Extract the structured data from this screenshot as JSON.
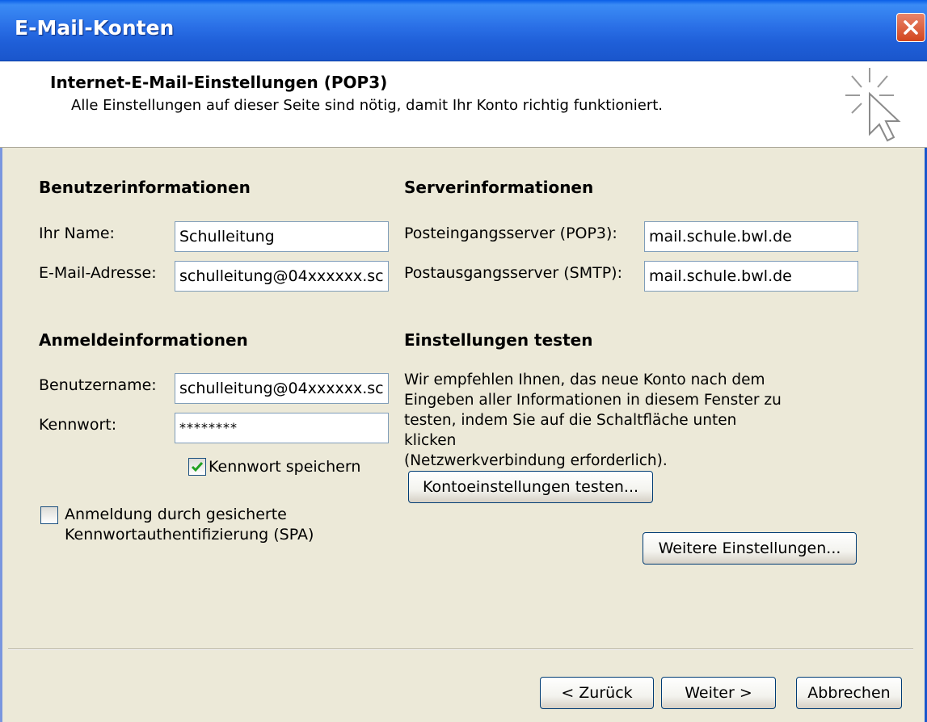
{
  "window": {
    "title": "E-Mail-Konten"
  },
  "header": {
    "title": "Internet-E-Mail-Einstellungen (POP3)",
    "subtitle": "Alle Einstellungen auf dieser Seite sind nötig, damit Ihr Konto richtig funktioniert."
  },
  "user_info": {
    "heading": "Benutzerinformationen",
    "name_label": "Ihr Name:",
    "name_value": "Schulleitung",
    "email_label": "E-Mail-Adresse:",
    "email_value": "schulleitung@04xxxxxx.sc"
  },
  "server_info": {
    "heading": "Serverinformationen",
    "incoming_label": "Posteingangsserver (POP3):",
    "incoming_value": "mail.schule.bwl.de",
    "outgoing_label": "Postausgangsserver (SMTP):",
    "outgoing_value": "mail.schule.bwl.de"
  },
  "login_info": {
    "heading": "Anmeldeinformationen",
    "username_label": "Benutzername:",
    "username_value": "schulleitung@04xxxxxx.sc",
    "password_label": "Kennwort:",
    "password_value": "********",
    "save_password_label": "Kennwort speichern",
    "save_password_checked": true,
    "spa_label_line1": "Anmeldung durch gesicherte",
    "spa_label_line2": "Kennwortauthentifizierung (SPA)",
    "spa_checked": false
  },
  "test_settings": {
    "heading": "Einstellungen testen",
    "line1": "Wir empfehlen Ihnen, das neue Konto nach dem",
    "line2": "Eingeben aller Informationen in diesem Fenster zu",
    "line3": "testen, indem Sie auf die Schaltfläche unten klicken",
    "line4": "(Netzwerkverbindung erforderlich).",
    "test_button": "Kontoeinstellungen testen..."
  },
  "more_settings_button": "Weitere Einstellungen...",
  "footer": {
    "back": "< Zurück",
    "next": "Weiter >",
    "cancel": "Abbrechen"
  }
}
